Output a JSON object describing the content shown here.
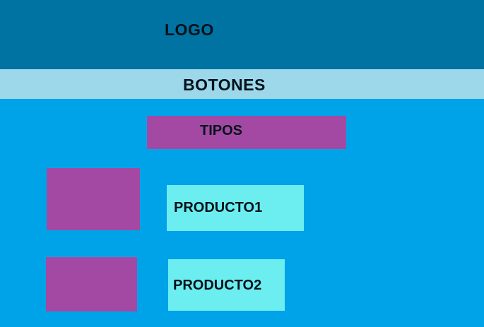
{
  "colors": {
    "header": "#0073a3",
    "nav": "#9cd8ea",
    "background": "#00a2e8",
    "purple": "#a349a4",
    "cyan": "#6ceef0"
  },
  "header": {
    "logo_label": "LOGO"
  },
  "nav": {
    "buttons_label": "BOTONES"
  },
  "main": {
    "types_label": "TIPOS",
    "products": [
      {
        "label": "PRODUCTO1"
      },
      {
        "label": "PRODUCTO2"
      }
    ]
  }
}
